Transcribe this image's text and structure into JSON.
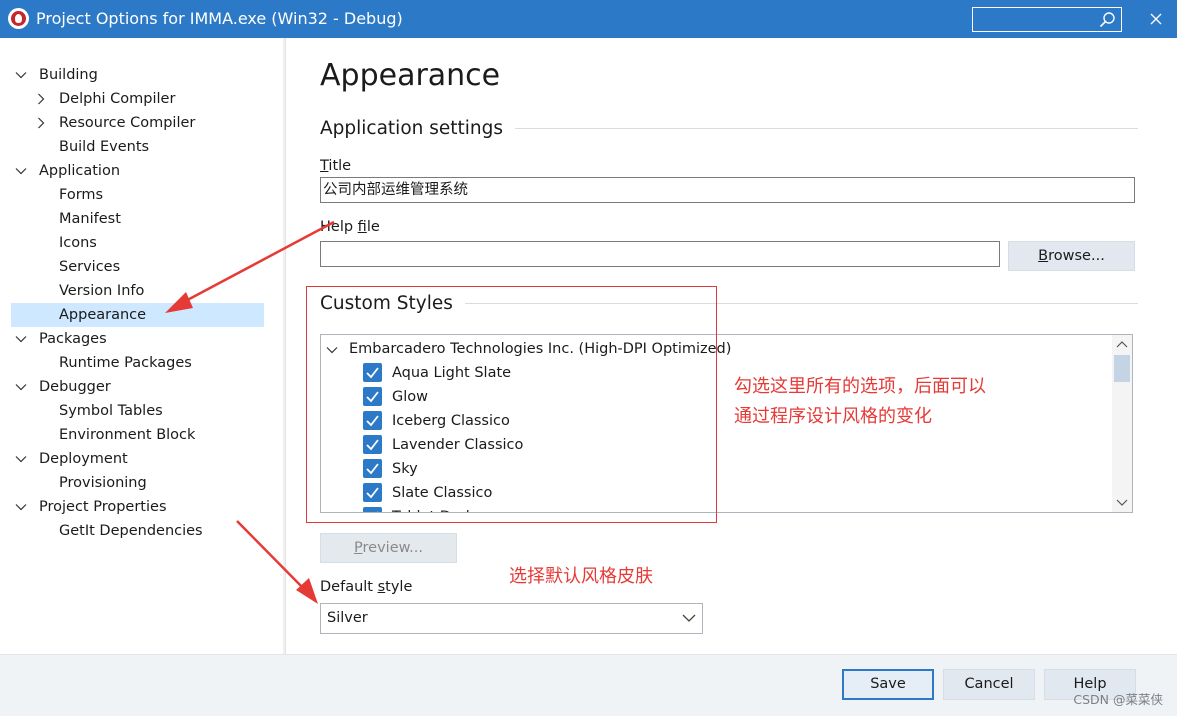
{
  "window": {
    "title": "Project Options for IMMA.exe  (Win32 - Debug)",
    "search_placeholder": ""
  },
  "tree": [
    {
      "label": "Building",
      "level": 0,
      "expander": "expanded"
    },
    {
      "label": "Delphi Compiler",
      "level": 1,
      "expander": "collapsed"
    },
    {
      "label": "Resource Compiler",
      "level": 1,
      "expander": "collapsed"
    },
    {
      "label": "Build Events",
      "level": 1,
      "expander": "none"
    },
    {
      "label": "Application",
      "level": 0,
      "expander": "expanded"
    },
    {
      "label": "Forms",
      "level": 1,
      "expander": "none"
    },
    {
      "label": "Manifest",
      "level": 1,
      "expander": "none"
    },
    {
      "label": "Icons",
      "level": 1,
      "expander": "none"
    },
    {
      "label": "Services",
      "level": 1,
      "expander": "none"
    },
    {
      "label": "Version Info",
      "level": 1,
      "expander": "none"
    },
    {
      "label": "Appearance",
      "level": 1,
      "expander": "none",
      "selected": true
    },
    {
      "label": "Packages",
      "level": 0,
      "expander": "expanded"
    },
    {
      "label": "Runtime Packages",
      "level": 1,
      "expander": "none"
    },
    {
      "label": "Debugger",
      "level": 0,
      "expander": "expanded"
    },
    {
      "label": "Symbol Tables",
      "level": 1,
      "expander": "none"
    },
    {
      "label": "Environment Block",
      "level": 1,
      "expander": "none"
    },
    {
      "label": "Deployment",
      "level": 0,
      "expander": "expanded"
    },
    {
      "label": "Provisioning",
      "level": 1,
      "expander": "none"
    },
    {
      "label": "Project Properties",
      "level": 0,
      "expander": "expanded"
    },
    {
      "label": "GetIt Dependencies",
      "level": 1,
      "expander": "none"
    }
  ],
  "page": {
    "heading": "Appearance",
    "app_settings_group": "Application settings",
    "title_label_mnemonic": "T",
    "title_label_rest": "itle",
    "title_value": "公司内部运维管理系统",
    "help_label_pre": "Help ",
    "help_label_mnemonic": "f",
    "help_label_rest": "ile",
    "help_value": "",
    "browse_mnemonic": "B",
    "browse_rest": "rowse...",
    "custom_styles_group": "Custom Styles",
    "styles_root": "Embarcadero Technologies Inc. (High-DPI Optimized)",
    "styles": [
      {
        "label": "Aqua Light Slate",
        "checked": true
      },
      {
        "label": "Glow",
        "checked": true
      },
      {
        "label": "Iceberg Classico",
        "checked": true
      },
      {
        "label": "Lavender Classico",
        "checked": true
      },
      {
        "label": "Sky",
        "checked": true
      },
      {
        "label": "Slate Classico",
        "checked": true
      },
      {
        "label": "Tablet Dark",
        "checked": true
      }
    ],
    "preview_mnemonic": "P",
    "preview_rest": "review...",
    "default_style_pre": "Default ",
    "default_style_mnemonic": "s",
    "default_style_rest": "tyle",
    "default_style_value": "Silver"
  },
  "footer": {
    "save": "Save",
    "cancel": "Cancel",
    "help": "Help"
  },
  "annotations": {
    "note_line1": "勾选这里所有的选项，后面可以",
    "note_line2": "通过程序设计风格的变化",
    "default_note": "选择默认风格皮肤",
    "color": "#e53a36"
  },
  "watermark": "CSDN @菜菜侠",
  "colors": {
    "title_bar": "#2b79c7",
    "selection": "#cde8ff",
    "checkbox": "#2b79c7"
  }
}
